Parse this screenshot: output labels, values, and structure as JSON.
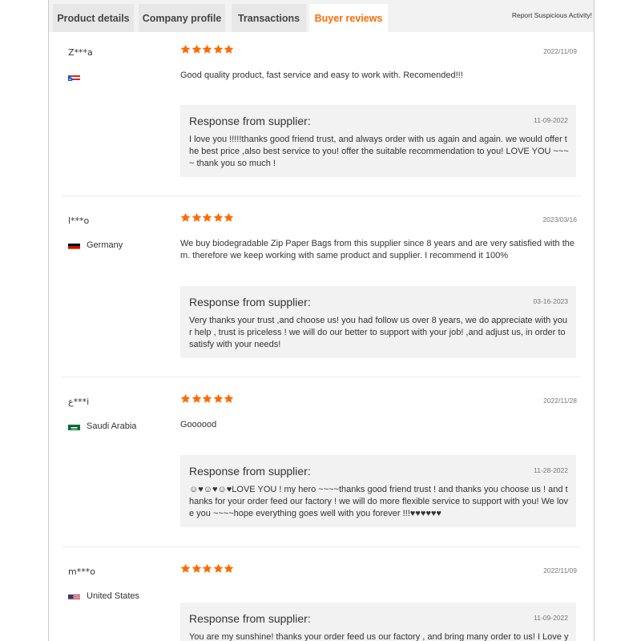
{
  "tabs": [
    {
      "label": "Product details"
    },
    {
      "label": "Company profile"
    },
    {
      "label": "Transactions"
    },
    {
      "label": "Buyer reviews"
    }
  ],
  "report_link": "Report Suspicious Activity!",
  "reply_title": "Response from supplier:",
  "reviews": [
    {
      "user": "Z***a",
      "country": "",
      "flag": "puerto-rico-flag-icon",
      "rating": 5,
      "date": "2022/11/09",
      "comment": "Good quality product, fast service and easy to work with. Recomended!!!",
      "reply_date": "11-09-2022",
      "reply": "I love you !!!!!thanks good friend trust, and always order with us again and again. we would offer the best price ,also best service to you! offer the suitable recommendation to you! LOVE YOU ~~~~ thank you so much !"
    },
    {
      "user": "l***o",
      "country": "Germany",
      "flag": "germany-flag-icon",
      "rating": 5,
      "date": "2023/03/16",
      "comment": "We buy biodegradable Zip Paper Bags from this supplier since 8 years and are very satisfied with them. therefore we keep working with same product and supplier. I recommend it 100%",
      "reply_date": "03-16-2023",
      "reply": "Very thanks your trust ,and choose us! you had follow us over 8 years, we do appreciate with your help , trust is priceless !  we will do our better to support with your job! ,and adjust us, in order to satisfy with your needs!"
    },
    {
      "user": "ع***i",
      "country": "Saudi Arabia",
      "flag": "saudi-arabia-flag-icon",
      "rating": 5,
      "date": "2022/11/28",
      "comment": "Goooood",
      "reply_date": "11-28-2022",
      "reply": "☺♥☺♥☺♥LOVE YOU ! my hero ~~~~thanks good friend trust ! and thanks you choose us ! and thanks for your order feed our factory ! we will do more flexible service to support with you! We love you ~~~~hope everything goes well with you forever !!!♥♥♥♥♥♥"
    },
    {
      "user": "m***o",
      "country": "United States",
      "flag": "united-states-flag-icon",
      "rating": 5,
      "date": "2022/11/09",
      "comment": "",
      "reply_date": "11-09-2022",
      "reply": "You are my sunshine! thanks your order feed us our factory , and bring many order to us! I Love you"
    }
  ],
  "colors": {
    "accent": "#ff6a00",
    "reply_bg": "#f2f2f2",
    "tab_bg": "#e7e7e7"
  }
}
